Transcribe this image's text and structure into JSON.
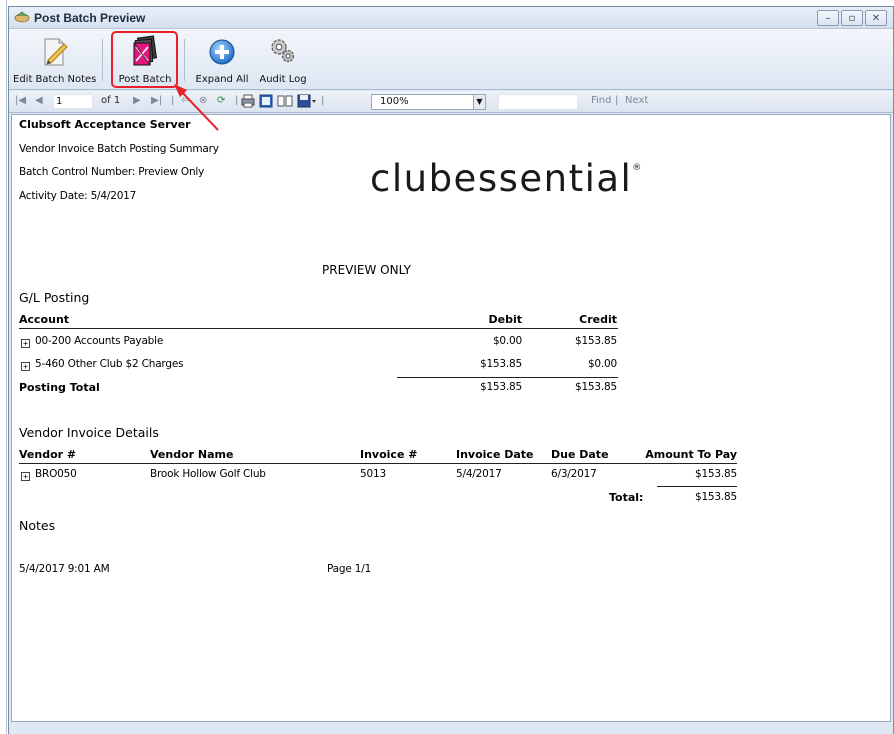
{
  "window": {
    "title": "Post Batch Preview"
  },
  "toolbar": {
    "edit_batch_notes": "Edit Batch Notes",
    "post_batch": "Post Batch",
    "expand_all": "Expand All",
    "audit_log": "Audit Log"
  },
  "report_toolbar": {
    "page_value": "1",
    "page_of": "of 1",
    "zoom": "100%",
    "find": "Find",
    "separator": "|",
    "next": "Next"
  },
  "report": {
    "company": "Clubsoft Acceptance Server",
    "report_title": "Vendor Invoice Batch Posting Summary",
    "batch_control": "Batch Control Number: Preview Only",
    "activity_date": "Activity Date: 5/4/2017",
    "logo_text": "clubessential",
    "preview_label": "PREVIEW ONLY",
    "gl_section": "G/L Posting",
    "gl_headers": {
      "account": "Account",
      "debit": "Debit",
      "credit": "Credit"
    },
    "gl_rows": [
      {
        "account": "00-200 Accounts Payable",
        "debit": "$0.00",
        "credit": "$153.85"
      },
      {
        "account": "5-460 Other Club $2 Charges",
        "debit": "$153.85",
        "credit": "$0.00"
      }
    ],
    "gl_total": {
      "label": "Posting Total",
      "debit": "$153.85",
      "credit": "$153.85"
    },
    "vendor_section": "Vendor Invoice Details",
    "vendor_headers": {
      "vendor_num": "Vendor #",
      "vendor_name": "Vendor Name",
      "invoice_num": "Invoice #",
      "invoice_date": "Invoice Date",
      "due_date": "Due Date",
      "amount": "Amount To Pay"
    },
    "vendor_rows": [
      {
        "vendor_num": "BRO050",
        "vendor_name": "Brook Hollow Golf Club",
        "invoice_num": "5013",
        "invoice_date": "5/4/2017",
        "due_date": "6/3/2017",
        "amount": "$153.85"
      }
    ],
    "vendor_total": {
      "label": "Total:",
      "amount": "$153.85"
    },
    "notes_section": "Notes",
    "footer_timestamp": "5/4/2017 9:01 AM",
    "footer_page": "Page 1/1"
  },
  "colors": {
    "highlight": "#e8202a",
    "window_bg": "#dfe8f5"
  }
}
